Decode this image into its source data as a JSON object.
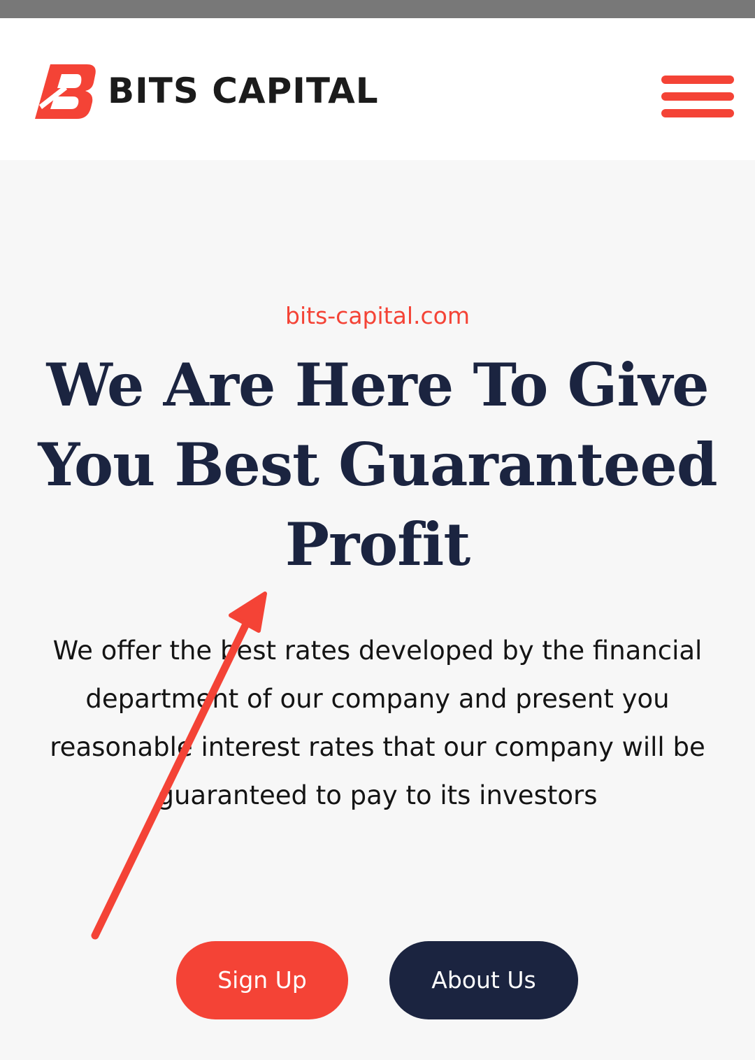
{
  "header": {
    "brand_name": "BITS CAPITAL",
    "logo_icon": "bits-capital-b-logo-icon",
    "menu_icon": "hamburger-menu-icon"
  },
  "hero": {
    "eyebrow": "bits-capital.com",
    "headline": "We Are Here To Give You Best Guaranteed Profit",
    "description": "We offer the best rates developed by the financial department of our company and present you reasonable interest rates that our company will be guaranteed to pay to its investors"
  },
  "actions": {
    "signup_label": "Sign Up",
    "about_label": "About Us"
  },
  "annotation": {
    "icon": "red-arrow-annotation"
  },
  "colors": {
    "accent": "#f44336",
    "navy": "#1b2440",
    "background": "#f7f7f7",
    "header_bg": "#ffffff",
    "status_strip": "#787878"
  }
}
